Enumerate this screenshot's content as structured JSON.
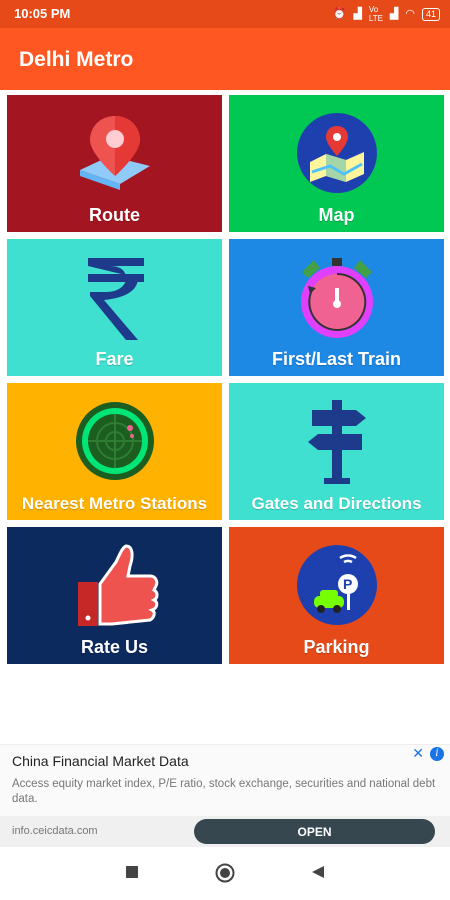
{
  "status_bar": {
    "time": "10:05 PM",
    "network": "Vo LTE",
    "battery": "41"
  },
  "app_bar": {
    "title": "Delhi Metro"
  },
  "tiles": [
    {
      "label": "Route",
      "icon": "map-pin-icon",
      "color": "#a31621"
    },
    {
      "label": "Map",
      "icon": "map-icon",
      "color": "#00c853"
    },
    {
      "label": "Fare",
      "icon": "rupee-icon",
      "color": "#40e0d0"
    },
    {
      "label": "First/Last Train",
      "icon": "stopwatch-icon",
      "color": "#1e88e5"
    },
    {
      "label": "Nearest Metro Stations",
      "icon": "radar-icon",
      "color": "#ffb300"
    },
    {
      "label": "Gates and Directions",
      "icon": "signpost-icon",
      "color": "#40e0d0"
    },
    {
      "label": "Rate Us",
      "icon": "thumbs-up-icon",
      "color": "#0d2a5e"
    },
    {
      "label": "Parking",
      "icon": "parking-icon",
      "color": "#e64a19"
    }
  ],
  "ad": {
    "title": "China Financial Market Data",
    "description": "Access equity market index, P/E ratio, stock exchange, securities and national debt data.",
    "url": "info.ceicdata.com",
    "cta": "OPEN"
  },
  "nav": {
    "recent_icon": "square-icon",
    "home_icon": "circle-icon",
    "back_icon": "triangle-back-icon"
  }
}
